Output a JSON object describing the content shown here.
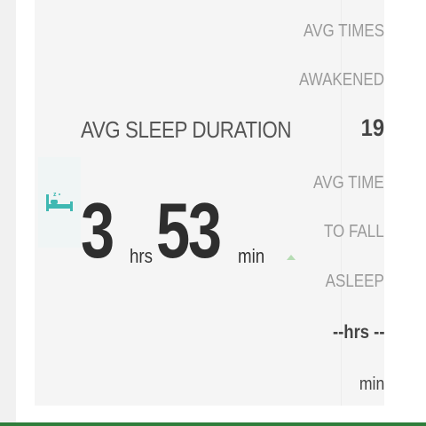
{
  "sleep_duration": {
    "title": "AVG SLEEP DURATION",
    "hours": "3",
    "hours_unit": "hrs",
    "minutes": "53",
    "minutes_unit": "min",
    "trend": "up"
  },
  "times_awakened": {
    "label_line1": "AVG TIMES",
    "label_line2": "AWAKENED",
    "value": "19"
  },
  "time_to_fall_asleep": {
    "label_line1": "AVG TIME",
    "label_line2": "TO FALL",
    "label_line3": "ASLEEP",
    "hours_value": "--hrs --",
    "minutes_unit": "min"
  },
  "icons": {
    "sleep": "bed-icon",
    "trend": "trend-up-icon"
  },
  "colors": {
    "bed_icon": "#3fb8b2",
    "trend_up": "#b6dcb4",
    "bottom_bar": "#2f7d3b"
  }
}
